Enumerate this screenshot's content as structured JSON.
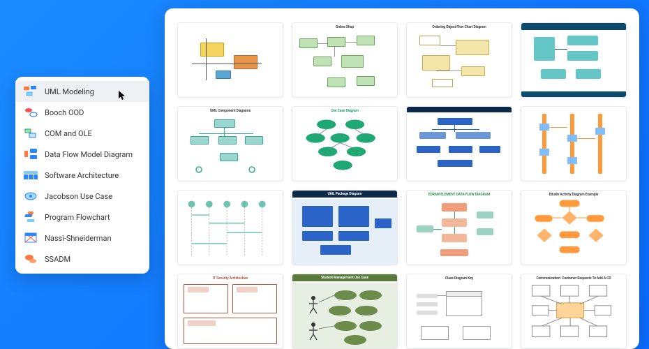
{
  "sidebar": {
    "items": [
      {
        "label": "UML Modeling",
        "icon": "uml-icon",
        "active": true
      },
      {
        "label": "Booch OOD",
        "icon": "booch-icon"
      },
      {
        "label": "COM and OLE",
        "icon": "comole-icon"
      },
      {
        "label": "Data Flow Model Diagram",
        "icon": "dataflow-icon"
      },
      {
        "label": "Software Architecture",
        "icon": "architecture-icon"
      },
      {
        "label": "Jacobson Use Case",
        "icon": "jacobson-icon"
      },
      {
        "label": "Program Flowchart",
        "icon": "flowchart-icon"
      },
      {
        "label": "Nassi-Shneiderman",
        "icon": "nassi-icon"
      },
      {
        "label": "SSADM",
        "icon": "ssadm-icon"
      }
    ]
  },
  "gallery": {
    "templates": [
      {
        "title": ""
      },
      {
        "title": "Online Shop"
      },
      {
        "title": "Ordering Object Flow Chart Diagram"
      },
      {
        "title": ""
      },
      {
        "title": "UML Component Diagrams"
      },
      {
        "title": "Use Case Diagram"
      },
      {
        "title": ""
      },
      {
        "title": ""
      },
      {
        "title": ""
      },
      {
        "title": "UML Package Diagram"
      },
      {
        "title": "EDRAW ELEMENT DATA FLOW DIAGRAM"
      },
      {
        "title": "Edudiv Activity Diagram Example"
      },
      {
        "title": "IT Security Architecture"
      },
      {
        "title": "Student Management Use Case"
      },
      {
        "title": "Class Diagram Key"
      },
      {
        "title": "Communication: Customer Requests To Add A CD"
      }
    ]
  }
}
